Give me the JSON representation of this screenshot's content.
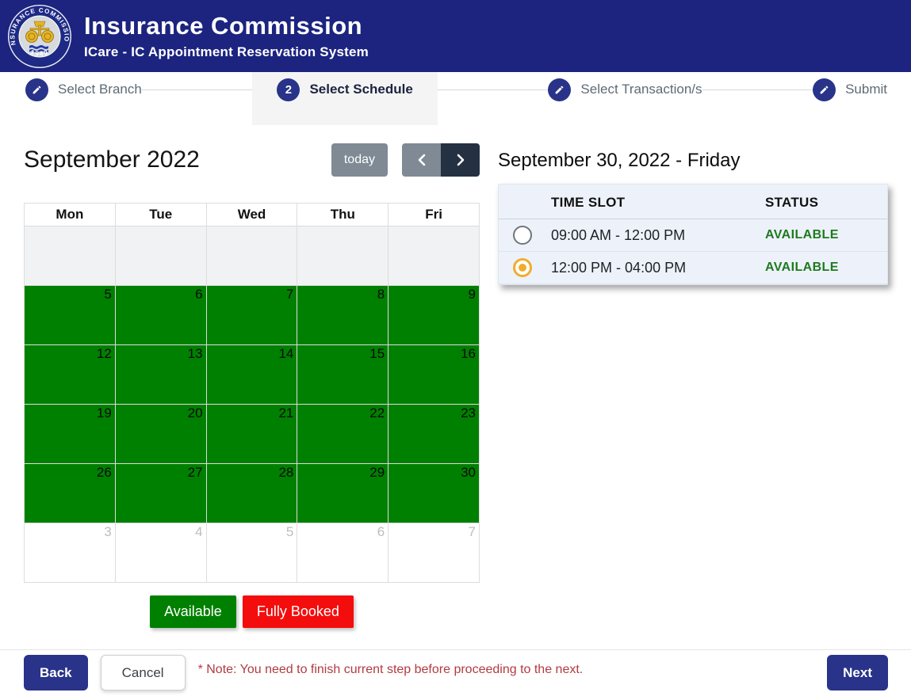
{
  "header": {
    "title": "Insurance Commission",
    "subtitle": "ICare - IC Appointment Reservation System",
    "seal": {
      "ring_text": "INSURANCE COMMISSION",
      "year": "1949"
    }
  },
  "steps": [
    {
      "label": "Select Branch",
      "icon": "pencil"
    },
    {
      "label": "Select Schedule",
      "number": "2",
      "active": true
    },
    {
      "label": "Select Transaction/s",
      "icon": "pencil"
    },
    {
      "label": "Submit",
      "icon": "pencil"
    }
  ],
  "calendar": {
    "title": "September 2022",
    "today_label": "today",
    "prev_icon": "chevron-left",
    "next_icon": "chevron-right",
    "day_headers": [
      "Mon",
      "Tue",
      "Wed",
      "Thu",
      "Fri"
    ],
    "weeks": [
      {
        "state": "disabled",
        "days": [
          "",
          "",
          "",
          "",
          ""
        ]
      },
      {
        "state": "available",
        "days": [
          "5",
          "6",
          "7",
          "8",
          "9"
        ]
      },
      {
        "state": "available",
        "days": [
          "12",
          "13",
          "14",
          "15",
          "16"
        ]
      },
      {
        "state": "available",
        "days": [
          "19",
          "20",
          "21",
          "22",
          "23"
        ]
      },
      {
        "state": "available",
        "days": [
          "26",
          "27",
          "28",
          "29",
          "30"
        ]
      },
      {
        "state": "other-month",
        "days": [
          "3",
          "4",
          "5",
          "6",
          "7"
        ]
      }
    ],
    "legend": [
      {
        "label": "Available",
        "color": "#008000"
      },
      {
        "label": "Fully Booked",
        "color": "#f40d0d"
      }
    ]
  },
  "schedule": {
    "date_title": "September 30, 2022 - Friday",
    "columns": [
      "TIME SLOT",
      "STATUS"
    ],
    "slots": [
      {
        "time": "09:00 AM - 12:00 PM",
        "status": "AVAILABLE",
        "selected": false
      },
      {
        "time": "12:00 PM - 04:00 PM",
        "status": "AVAILABLE",
        "selected": true
      }
    ]
  },
  "footer": {
    "back_label": "Back",
    "cancel_label": "Cancel",
    "note": "* Note: You need to finish current step before proceeding to the next.",
    "next_label": "Next"
  },
  "colors": {
    "header_navy": "#1c2480",
    "accent_navy": "#283389",
    "available_green": "#008000",
    "booked_red": "#f40d0d",
    "status_green": "#1f7a1f",
    "note_red": "#b23b41",
    "toolbar_gray": "#7f8a94",
    "toolbar_dark": "#243142",
    "radio_gold": "#f0ad2d",
    "panel_blue": "#edf2fa"
  }
}
